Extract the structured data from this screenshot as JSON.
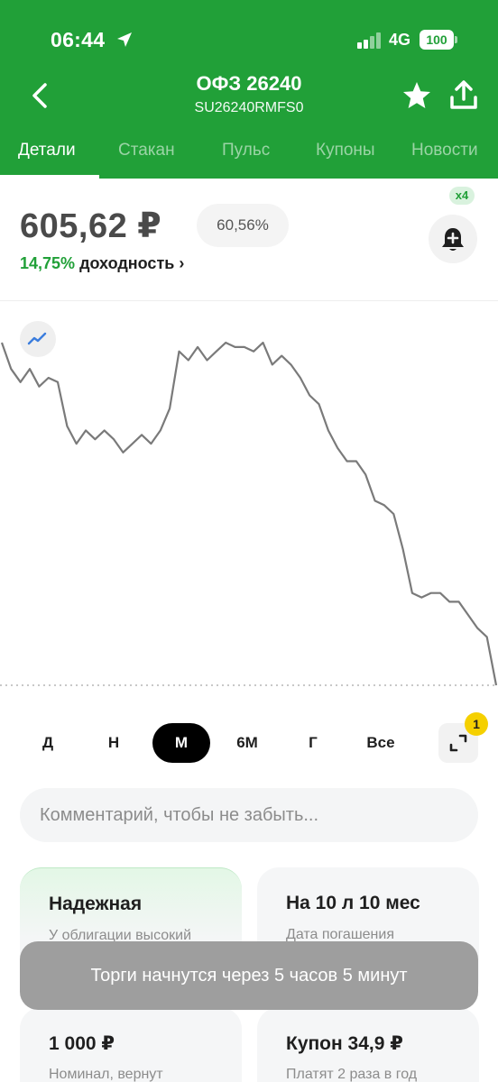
{
  "status_bar": {
    "time": "06:44",
    "network": "4G",
    "battery": "100"
  },
  "header": {
    "title": "ОФЗ 26240",
    "subtitle": "SU26240RMFS0",
    "tabs": [
      {
        "label": "Детали",
        "active": true
      },
      {
        "label": "Стакан",
        "active": false
      },
      {
        "label": "Пульс",
        "active": false
      },
      {
        "label": "Купоны",
        "active": false
      },
      {
        "label": "Новости",
        "active": false
      }
    ]
  },
  "quote": {
    "price": "605,62 ₽",
    "percent": "60,56%",
    "yield_value": "14,75%",
    "yield_label": "доходность ›",
    "alert_multiplier": "x4"
  },
  "periods": {
    "options": [
      "Д",
      "Н",
      "М",
      "6М",
      "Г",
      "Все"
    ],
    "selected": "М",
    "expand_badge": "1"
  },
  "comment": {
    "placeholder": "Комментарий, чтобы не забыть..."
  },
  "cards": [
    {
      "title": "Надежная",
      "subtitle": "У облигации высокий"
    },
    {
      "title": "На 10 л 10 мес",
      "subtitle": "Дата погашения"
    },
    {
      "title": "1 000 ₽",
      "subtitle": "Номинал, вернут"
    },
    {
      "title": "Купон 34,9 ₽",
      "subtitle": "Платят 2 раза в год"
    }
  ],
  "toast": {
    "text": "Торги начнутся через 5 часов 5 минут"
  },
  "colors": {
    "brand": "#21a038",
    "chart_line": "#7a7a7a",
    "badge": "#f5d000"
  },
  "chart_data": {
    "type": "line",
    "title": "",
    "xlabel": "",
    "ylabel": "",
    "grid": false,
    "series": [
      {
        "values": [
          100,
          94,
          91,
          94,
          90,
          92,
          91,
          81,
          77,
          80,
          78,
          80,
          78,
          75,
          77,
          79,
          77,
          80,
          85,
          98,
          96,
          99,
          96,
          98,
          100,
          99,
          99,
          98,
          100,
          95,
          97,
          95,
          92,
          88,
          86,
          80,
          76,
          73,
          73,
          70,
          64,
          63,
          61,
          53,
          43,
          42,
          43,
          43,
          41,
          41,
          38,
          35,
          33,
          22
        ]
      }
    ]
  }
}
